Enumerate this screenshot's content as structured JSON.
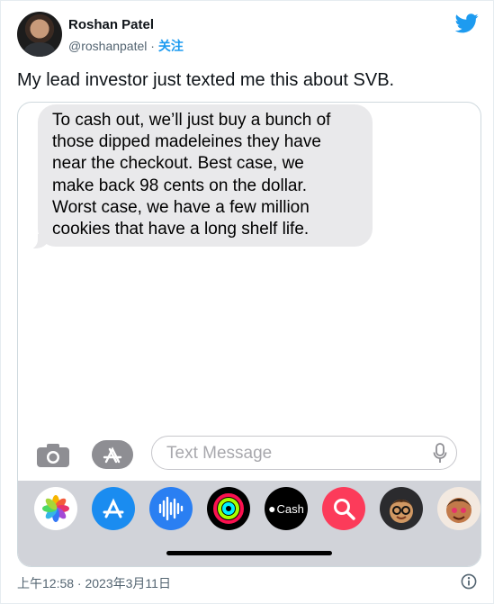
{
  "author": {
    "name": "Roshan Patel",
    "handle": "@roshanpatel",
    "separator": "·",
    "follow_label": "关注"
  },
  "tweet": {
    "text": "My lead investor just texted me this about SVB.",
    "timestamp": "上午12:58 · 2023年3月11日"
  },
  "screenshot": {
    "message_lines": [
      "To cash out, we’ll just buy a bunch of",
      "those dipped madeleines they have",
      "near the checkout. Best case, we",
      "make back 98 cents on the dollar.",
      "Worst case, we have a few million",
      "cookies that have a long shelf life."
    ],
    "input_placeholder": "Text Message",
    "apps": [
      {
        "name": "photos-app-icon"
      },
      {
        "name": "app-store-app-icon"
      },
      {
        "name": "audio-message-app-icon"
      },
      {
        "name": "activity-app-icon"
      },
      {
        "name": "apple-cash-app-icon",
        "label": "Cash"
      },
      {
        "name": "search-images-app-icon"
      },
      {
        "name": "memoji-app-icon"
      },
      {
        "name": "memoji-stickers-app-icon"
      }
    ]
  },
  "colors": {
    "accent": "#1d9bf0",
    "bubble": "#e9e9eb",
    "tray": "#d1d3d9"
  }
}
